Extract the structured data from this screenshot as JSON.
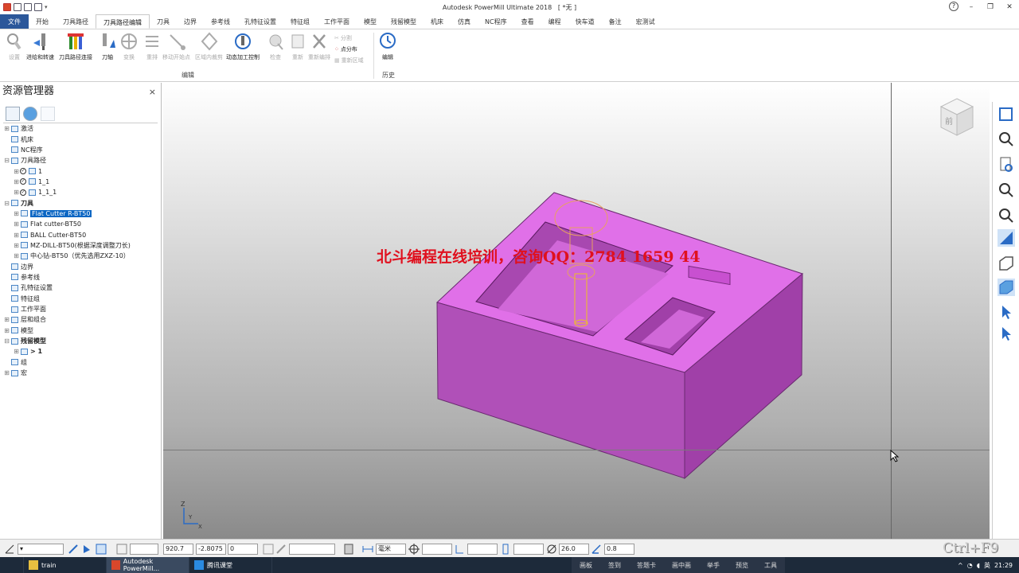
{
  "title_bar": {
    "app_title": "Autodesk PowerMill Ultimate 2018",
    "doc_title": "[ *无 ]",
    "help": "?"
  },
  "ribbon_tabs": [
    "文件",
    "开始",
    "刀具路径",
    "刀具路径编辑",
    "刀具",
    "边界",
    "参考线",
    "孔特征设置",
    "特征组",
    "工作平面",
    "模型",
    "残留模型",
    "机床",
    "仿真",
    "NC程序",
    "查看",
    "编程",
    "快车道",
    "备注",
    "宏测试"
  ],
  "ribbon": {
    "buttons": [
      "设置",
      "进给和转速",
      "刀具路径连接",
      "刀轴",
      "变换",
      "重排",
      "移动开始点",
      "区域内裁剪",
      "动态加工控制",
      "检查",
      "重新",
      "重新编排"
    ],
    "small_buttons": [
      "分割",
      "点分布",
      "重新区域"
    ],
    "history_button": "编辑",
    "group_edit": "编辑",
    "group_history": "历史"
  },
  "explorer": {
    "title": "资源管理器",
    "close": "×",
    "tree": [
      {
        "level": 0,
        "label": "激活",
        "expand": "⊞"
      },
      {
        "level": 0,
        "label": "机床",
        "expand": ""
      },
      {
        "level": 0,
        "label": "NC程序",
        "expand": ""
      },
      {
        "level": 0,
        "label": "刀具路径",
        "expand": "⊟"
      },
      {
        "level": 1,
        "label": "1",
        "expand": "⊞",
        "check": true
      },
      {
        "level": 1,
        "label": "1_1",
        "expand": "⊞",
        "check": true
      },
      {
        "level": 1,
        "label": "1_1_1",
        "expand": "⊞",
        "check": true
      },
      {
        "level": 0,
        "label": "刀具",
        "expand": "⊟",
        "bold": true
      },
      {
        "level": 1,
        "label": "Flat Cutter R-BT50",
        "expand": "⊞",
        "selected": true
      },
      {
        "level": 1,
        "label": "Flat cutter-BT50",
        "expand": "⊞"
      },
      {
        "level": 1,
        "label": "BALL Cutter-BT50",
        "expand": "⊞"
      },
      {
        "level": 1,
        "label": "MZ-DILL-BT50(根据深度调整刀长)",
        "expand": "⊞"
      },
      {
        "level": 1,
        "label": "中心钻-BT50（优先选用ZXZ-10）",
        "expand": "⊞"
      },
      {
        "level": 0,
        "label": "边界",
        "expand": ""
      },
      {
        "level": 0,
        "label": "参考线",
        "expand": ""
      },
      {
        "level": 0,
        "label": "孔特征设置",
        "expand": ""
      },
      {
        "level": 0,
        "label": "特征组",
        "expand": ""
      },
      {
        "level": 0,
        "label": "工作平面",
        "expand": ""
      },
      {
        "level": 0,
        "label": "层和组合",
        "expand": "⊞"
      },
      {
        "level": 0,
        "label": "模型",
        "expand": "⊞"
      },
      {
        "level": 0,
        "label": "残留模型",
        "expand": "⊟",
        "bold": true
      },
      {
        "level": 1,
        "label": "> 1",
        "expand": "⊞",
        "bold": true
      },
      {
        "level": 0,
        "label": "组",
        "expand": ""
      },
      {
        "level": 0,
        "label": "宏",
        "expand": "⊞"
      }
    ]
  },
  "viewport": {
    "watermark": "北斗编程在线培训，咨询QQ：2784 1659 44",
    "viewcube_face": "前",
    "axis_z": "Z",
    "axis_x": "X",
    "axis_y": "Y",
    "part_color": "#e070e8"
  },
  "status_bar": {
    "x": "920.7",
    "y": "-2.8075",
    "z": "0",
    "unit": "毫米",
    "diameter": "26.0",
    "tolerance": "0.8",
    "shortcut": "Ctrl+F9"
  },
  "taskbar": {
    "items": [
      "train",
      "Autodesk PowerMill...",
      "腾讯课堂"
    ],
    "mid": [
      "画板",
      "签到",
      "答题卡",
      "画中画",
      "举手",
      "预览",
      "工具"
    ],
    "ime": "英",
    "time": "21:29"
  }
}
